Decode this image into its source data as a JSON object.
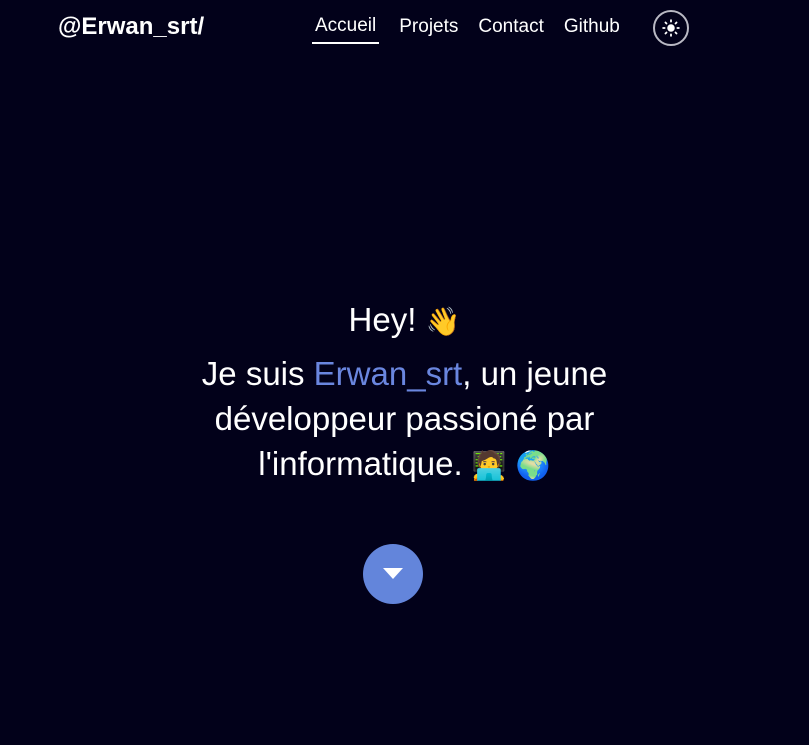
{
  "header": {
    "logo": "@Erwan_srt/",
    "nav": [
      {
        "label": "Accueil",
        "active": true
      },
      {
        "label": "Projets",
        "active": false
      },
      {
        "label": "Contact",
        "active": false
      },
      {
        "label": "Github",
        "active": false
      }
    ],
    "theme_toggle_icon": "sun-icon"
  },
  "hero": {
    "greeting": "Hey!",
    "greeting_emoji": "👋",
    "intro_before": "Je suis ",
    "intro_name": "Erwan_srt",
    "intro_after": ", un jeune développeur passioné par l'informatique.",
    "intro_emoji_1": "🧑‍💻",
    "intro_emoji_2": "🌍",
    "scroll_button_icon": "caret-down-icon"
  },
  "colors": {
    "background": "#02011a",
    "accent": "#6a86df",
    "button": "#6385db",
    "text": "#ffffff"
  }
}
